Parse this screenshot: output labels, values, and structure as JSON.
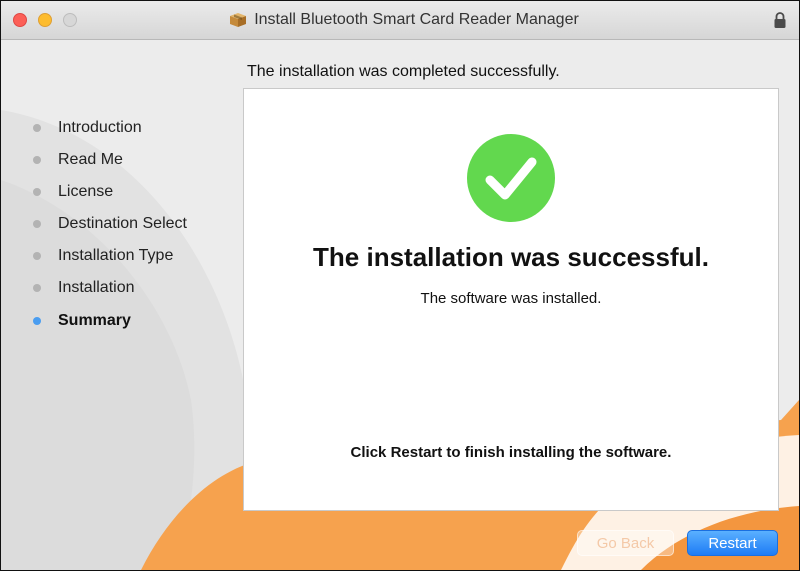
{
  "window": {
    "title": "Install Bluetooth Smart Card Reader Manager",
    "icons": {
      "app": "package-icon",
      "lock": "lock-icon"
    }
  },
  "header": {
    "message": "The installation was completed successfully."
  },
  "sidebar": {
    "items": [
      {
        "label": "Introduction",
        "active": false
      },
      {
        "label": "Read Me",
        "active": false
      },
      {
        "label": "License",
        "active": false
      },
      {
        "label": "Destination Select",
        "active": false
      },
      {
        "label": "Installation Type",
        "active": false
      },
      {
        "label": "Installation",
        "active": false
      },
      {
        "label": "Summary",
        "active": true
      }
    ]
  },
  "panel": {
    "icon": "success-check-icon",
    "title": "The installation was successful.",
    "subtitle": "The software was installed.",
    "note": "Click Restart to finish installing the software."
  },
  "buttons": {
    "go_back": {
      "label": "Go Back",
      "enabled": false
    },
    "restart": {
      "label": "Restart",
      "enabled": true
    }
  },
  "colors": {
    "accent": "#1e7cf5",
    "success": "#62d84e",
    "background_orange": "#f6a24e",
    "close": "#fc5f57",
    "minimize": "#fdbc2e"
  }
}
